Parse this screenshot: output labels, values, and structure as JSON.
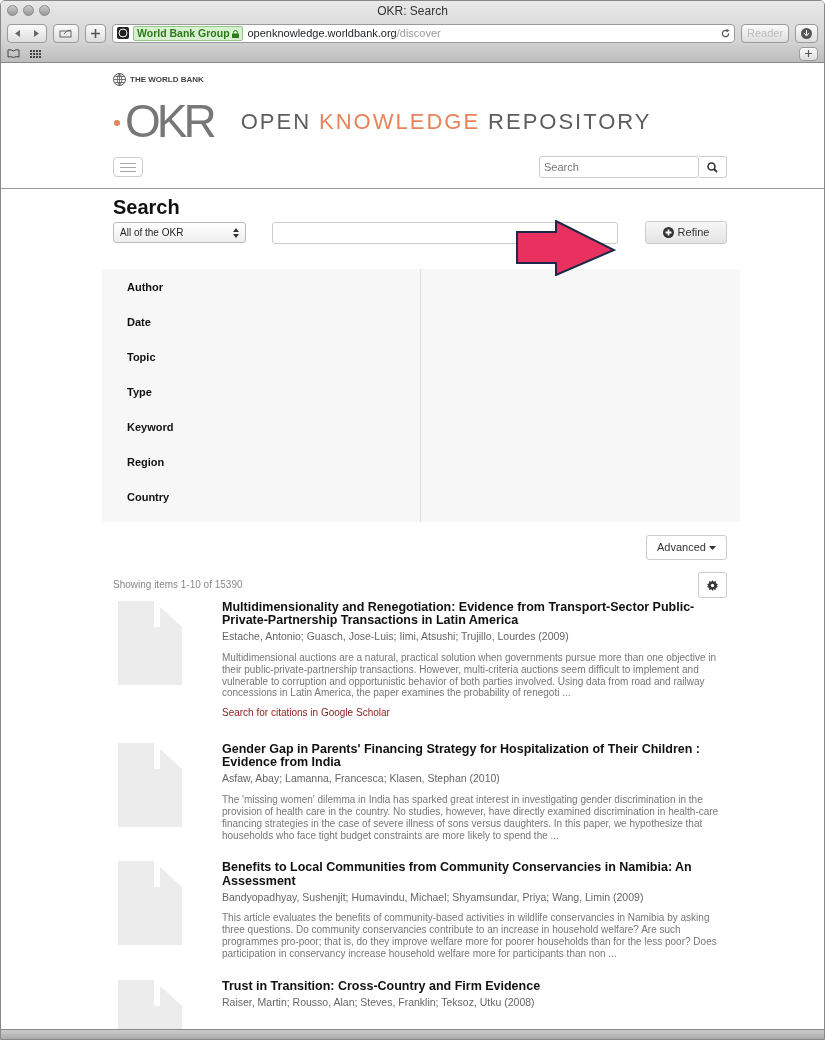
{
  "window": {
    "title": "OKR: Search"
  },
  "toolbar": {
    "site_badge": "World Bank Group",
    "url_host": "openknowledge.worldbank.org",
    "url_path": "/discover",
    "reader": "Reader"
  },
  "header": {
    "org": "THE WORLD BANK",
    "logo": "OKR",
    "tagline": [
      {
        "text": "OPEN",
        "accent": false
      },
      {
        "text": "KNOWLEDGE",
        "accent": true
      },
      {
        "text": "REPOSITORY",
        "accent": false
      }
    ],
    "search_placeholder": "Search"
  },
  "search": {
    "title": "Search",
    "scope": "All of the OKR",
    "refine": "Refine"
  },
  "facets": [
    {
      "label": "Author"
    },
    {
      "label": "Date"
    },
    {
      "label": "Topic"
    },
    {
      "label": "Type"
    },
    {
      "label": "Keyword"
    },
    {
      "label": "Region"
    },
    {
      "label": "Country"
    }
  ],
  "advanced": "Advanced",
  "showing": "Showing items 1-10 of 15390",
  "results": [
    {
      "title": "Multidimensionality and Renegotiation: Evidence from Transport-Sector Public-Private-Partnership Transactions in Latin America",
      "authors": "Estache, Antonio; Guasch, Jose-Luis; Iimi, Atsushi; Trujillo, Lourdes (2009)",
      "abstract": "Multidimensional auctions are a natural, practical solution when governments pursue more than one objective in their public-private-partnership transactions. However, multi-criteria auctions seem difficult to implement and vulnerable to corruption and opportunistic behavior of both parties involved. Using data from road and railway concessions in Latin America, the paper examines the probability of renegoti ...",
      "link": "Search for citations in Google Scholar"
    },
    {
      "title": "Gender Gap in Parents' Financing Strategy for Hospitalization of Their Children : Evidence from India",
      "authors": "Asfaw, Abay; Lamanna, Francesca; Klasen, Stephan (2010)",
      "abstract": "The 'missing women' dilemma in India has sparked great interest in investigating gender discrimination in the provision of health care in the country. No studies, however, have directly examined discrimination in health-care financing strategies in the case of severe illness of sons versus daughters. In this paper, we hypothesize that households who face tight budget constraints are more likely to spend the ..."
    },
    {
      "title": "Benefits to Local Communities from Community Conservancies in Namibia: An Assessment",
      "authors": "Bandyopadhyay, Sushenjit; Humavindu, Michael; Shyamsundar, Priya; Wang, Limin (2009)",
      "abstract": "This article evaluates the benefits of community-based activities in wildlife conservancies in Namibia by asking three questions. Do community conservancies contribute to an increase in household welfare? Are such programmes pro-poor; that is, do they improve welfare more for poorer households than for the less poor? Does participation in conservancy increase household welfare more for participants than non ..."
    },
    {
      "title": "Trust in Transition: Cross-Country and Firm Evidence",
      "authors": "Raiser, Martin; Rousso, Alan; Steves, Franklin; Teksoz, Utku (2008)"
    }
  ]
}
